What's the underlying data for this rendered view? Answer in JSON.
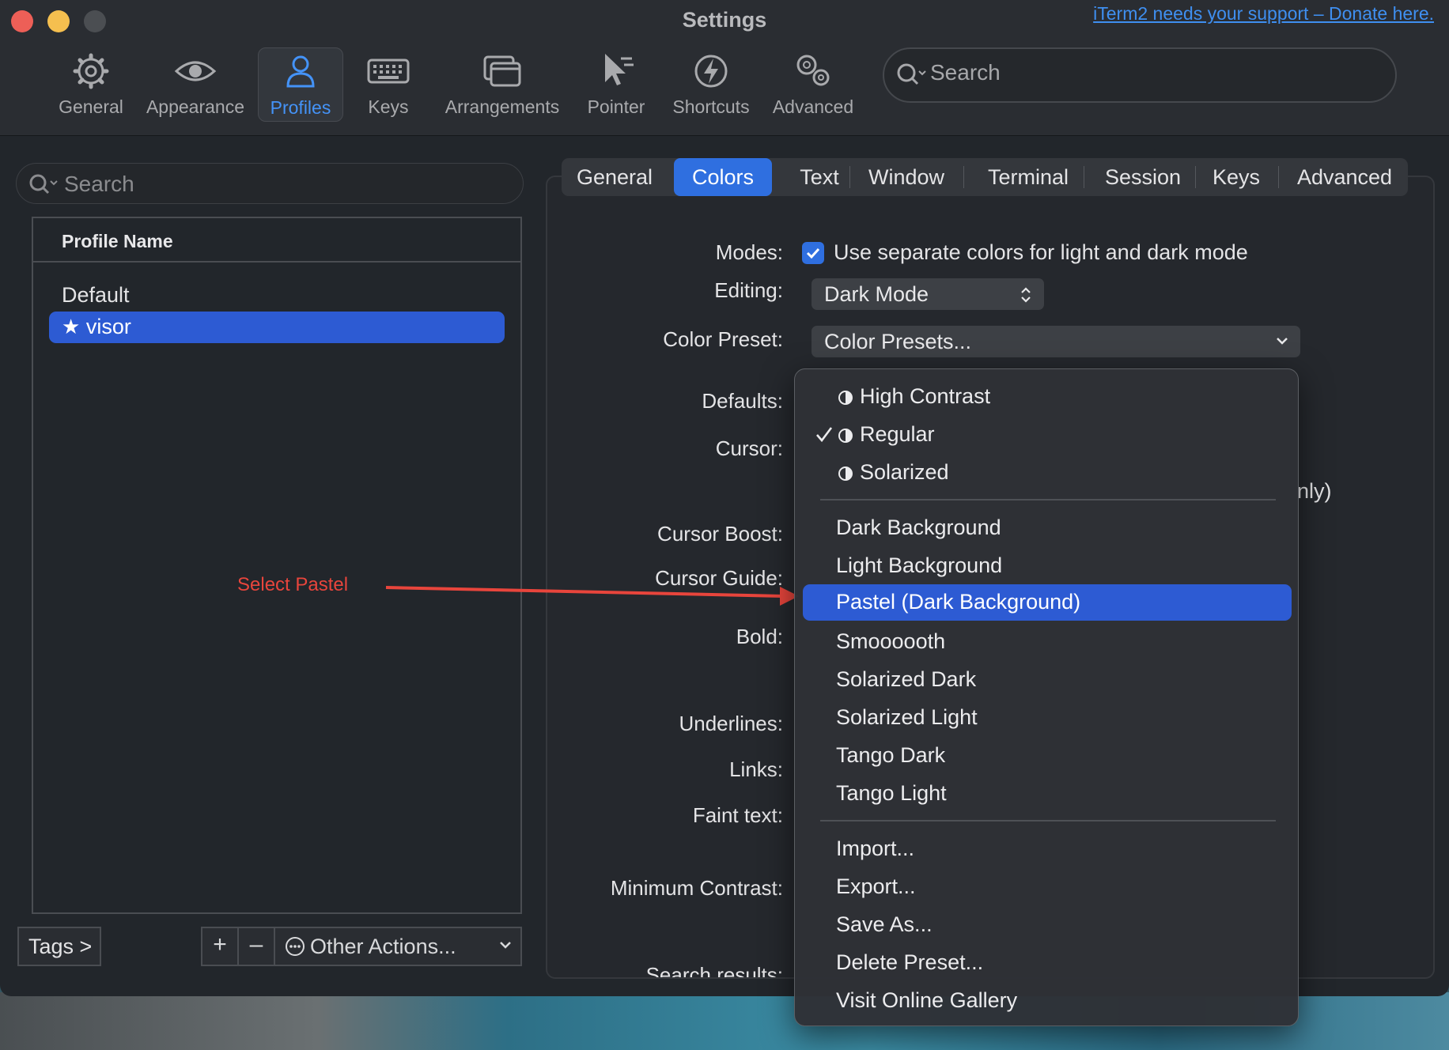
{
  "window": {
    "title": "Settings",
    "donate_link": "iTerm2 needs your support – Donate here."
  },
  "toolbar": {
    "items": [
      {
        "label": "General",
        "icon": "gear-icon"
      },
      {
        "label": "Appearance",
        "icon": "eye-icon"
      },
      {
        "label": "Profiles",
        "icon": "person-icon",
        "active": true
      },
      {
        "label": "Keys",
        "icon": "keyboard-icon"
      },
      {
        "label": "Arrangements",
        "icon": "windows-icon"
      },
      {
        "label": "Pointer",
        "icon": "cursor-icon"
      },
      {
        "label": "Shortcuts",
        "icon": "bolt-icon"
      },
      {
        "label": "Advanced",
        "icon": "gears-icon"
      }
    ],
    "search_placeholder": "Search"
  },
  "profiles": {
    "search_placeholder": "Search",
    "column_header": "Profile Name",
    "rows": [
      {
        "name": "Default"
      },
      {
        "name": "visor",
        "starred": true,
        "selected": true
      }
    ],
    "tags_label": "Tags >",
    "add_label": "+",
    "remove_label": "–",
    "other_actions_label": "Other Actions..."
  },
  "annotation": {
    "text": "Select Pastel",
    "color": "#e8453c"
  },
  "tabs": [
    {
      "label": "General"
    },
    {
      "label": "Colors",
      "active": true
    },
    {
      "label": "Text"
    },
    {
      "label": "Window"
    },
    {
      "label": "Terminal"
    },
    {
      "label": "Session"
    },
    {
      "label": "Keys"
    },
    {
      "label": "Advanced"
    }
  ],
  "colors_panel": {
    "labels": {
      "modes": "Modes:",
      "editing": "Editing:",
      "color_preset": "Color Preset:",
      "defaults": "Defaults:",
      "cursor": "Cursor:",
      "cursor_boost": "Cursor Boost:",
      "cursor_guide": "Cursor Guide:",
      "bold": "Bold:",
      "underlines": "Underlines:",
      "links": "Links:",
      "faint_text": "Faint text:",
      "minimum_contrast": "Minimum Contrast:",
      "search_results": "Search results:"
    },
    "modes_checkbox_label": "Use separate colors for light and dark mode",
    "modes_checked": true,
    "editing_value": "Dark Mode",
    "color_preset_value": "Color Presets...",
    "partial_text": "nly)"
  },
  "preset_menu": {
    "defaults_group": [
      {
        "label": "High Contrast",
        "checked": false
      },
      {
        "label": "Regular",
        "checked": true
      },
      {
        "label": "Solarized",
        "checked": false
      }
    ],
    "presets": [
      {
        "label": "Dark Background"
      },
      {
        "label": "Light Background"
      },
      {
        "label": "Pastel (Dark Background)",
        "highlighted": true
      },
      {
        "label": "Smoooooth"
      },
      {
        "label": "Solarized Dark"
      },
      {
        "label": "Solarized Light"
      },
      {
        "label": "Tango Dark"
      },
      {
        "label": "Tango Light"
      }
    ],
    "actions": [
      {
        "label": "Import..."
      },
      {
        "label": "Export..."
      },
      {
        "label": "Save As..."
      },
      {
        "label": "Delete Preset..."
      },
      {
        "label": "Visit Online Gallery"
      }
    ]
  },
  "theme": {
    "accent": "#2f6fe0",
    "selection": "#2d5bd3",
    "link": "#3f8ff0",
    "active_toolbar": "#4493f8"
  }
}
